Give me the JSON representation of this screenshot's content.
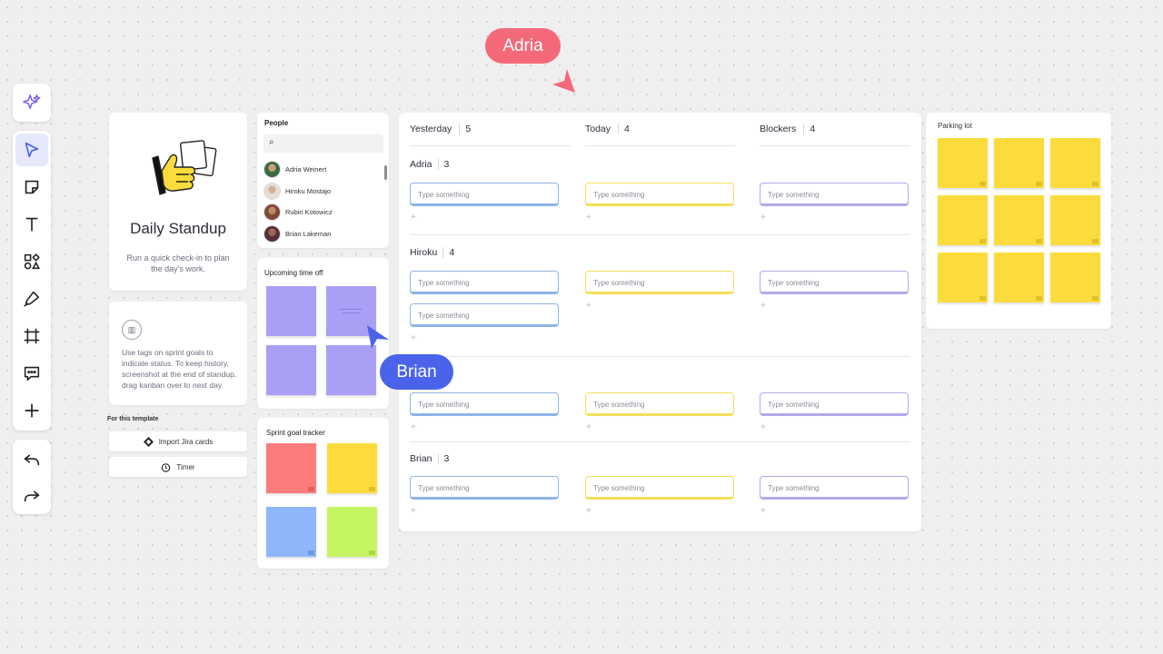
{
  "colors": {
    "accent": "#4b63ea",
    "sticky_purple": "#a9a0f6",
    "sticky_yellow": "#fbdc3c",
    "sticky_red": "#fb7c7a",
    "sticky_blue": "#8fb6fb",
    "sticky_green": "#c6f564",
    "cursor_adria": "#f4697a",
    "cursor_brian": "#4b63ea"
  },
  "toolbar": {
    "icons": [
      "ai-sparkle-icon",
      "select-arrow-icon",
      "sticky-note-icon",
      "text-icon",
      "shapes-icon",
      "pen-icon",
      "frame-icon",
      "comment-icon",
      "plus-icon",
      "undo-icon",
      "redo-icon"
    ]
  },
  "intro": {
    "title": "Daily Standup",
    "description": "Run a quick check-in to plan the day's work."
  },
  "tip": {
    "text": "Use tags on sprint goals to indicate status. To keep history, screenshot at the end of standup, drag kanban over to next day."
  },
  "template": {
    "section_label": "For this template",
    "import_label": "Import Jira cards",
    "timer_label": "Timer"
  },
  "people": {
    "title": "People",
    "list": [
      {
        "name": "Adria Weinert"
      },
      {
        "name": "Hiroku Mostajo"
      },
      {
        "name": "Rubin Kotowicz"
      },
      {
        "name": "Brian Lakeman"
      }
    ]
  },
  "time_off": {
    "title": "Upcoming time off"
  },
  "sprint": {
    "title": "Sprint goal tracker"
  },
  "board": {
    "columns": [
      {
        "label": "Yesterday",
        "count": "5"
      },
      {
        "label": "Today",
        "count": "4"
      },
      {
        "label": "Blockers",
        "count": "4"
      }
    ],
    "rows": [
      {
        "name": "Adria",
        "count": "3"
      },
      {
        "name": "Hiroku",
        "count": "4"
      },
      {
        "name": "Brian",
        "count": "3"
      }
    ],
    "placeholder": "Type something",
    "add_symbol": "+"
  },
  "parking": {
    "title": "Parking lot"
  },
  "cursors": {
    "adria": "Adria",
    "brian": "Brian"
  }
}
